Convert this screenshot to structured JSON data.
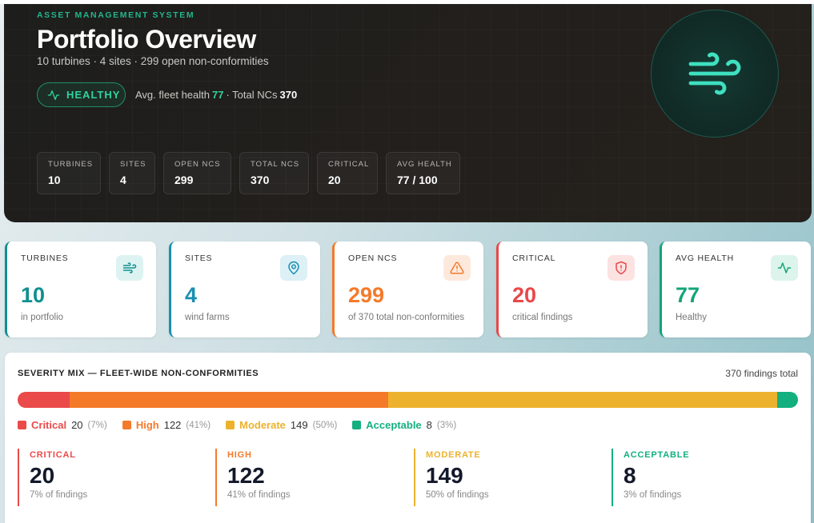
{
  "hero": {
    "eyebrow": "ASSET MANAGEMENT SYSTEM",
    "title": "Portfolio Overview",
    "subtitle": "10 turbines · 4 sites · 299 open non-conformities",
    "status_label": "HEALTHY",
    "health_prefix": "Avg. fleet health",
    "health_value": "77",
    "total_prefix": "· Total NCs",
    "total_value": "370",
    "chips": [
      {
        "label": "TURBINES",
        "value": "10"
      },
      {
        "label": "SITES",
        "value": "4"
      },
      {
        "label": "OPEN NCS",
        "value": "299"
      },
      {
        "label": "TOTAL NCS",
        "value": "370"
      },
      {
        "label": "CRITICAL",
        "value": "20"
      },
      {
        "label": "AVG HEALTH",
        "value": "77 / 100"
      }
    ]
  },
  "kpis": [
    {
      "label": "TURBINES",
      "value": "10",
      "sub": "in portfolio",
      "color": "#0f8f8f",
      "icon": "wind-icon"
    },
    {
      "label": "SITES",
      "value": "4",
      "sub": "wind farms",
      "color": "#1a8fb0",
      "icon": "map-pin-icon"
    },
    {
      "label": "OPEN NCS",
      "value": "299",
      "sub": "of 370 total non-conformities",
      "color": "#f47a2a",
      "icon": "warning-triangle-icon"
    },
    {
      "label": "CRITICAL",
      "value": "20",
      "sub": "critical findings",
      "color": "#e8484a",
      "icon": "shield-alert-icon"
    },
    {
      "label": "AVG HEALTH",
      "value": "77",
      "sub": "Healthy",
      "color": "#12a578",
      "icon": "activity-icon"
    }
  ],
  "severity": {
    "title": "SEVERITY MIX — FLEET-WIDE NON-CONFORMITIES",
    "total": "370 findings total",
    "levels": [
      {
        "name": "Critical",
        "label": "CRITICAL",
        "count": "20",
        "pct": "(7%)",
        "share": 20,
        "sub": "7% of findings",
        "color": "#ea4a4a"
      },
      {
        "name": "High",
        "label": "HIGH",
        "count": "122",
        "pct": "(41%)",
        "share": 122,
        "sub": "41% of findings",
        "color": "#f47a2a"
      },
      {
        "name": "Moderate",
        "label": "MODERATE",
        "count": "149",
        "pct": "(50%)",
        "share": 149,
        "sub": "50% of findings",
        "color": "#ecb22e"
      },
      {
        "name": "Acceptable",
        "label": "ACCEPTABLE",
        "count": "8",
        "pct": "(3%)",
        "share": 8,
        "sub": "3% of findings",
        "color": "#12b07f"
      }
    ]
  }
}
